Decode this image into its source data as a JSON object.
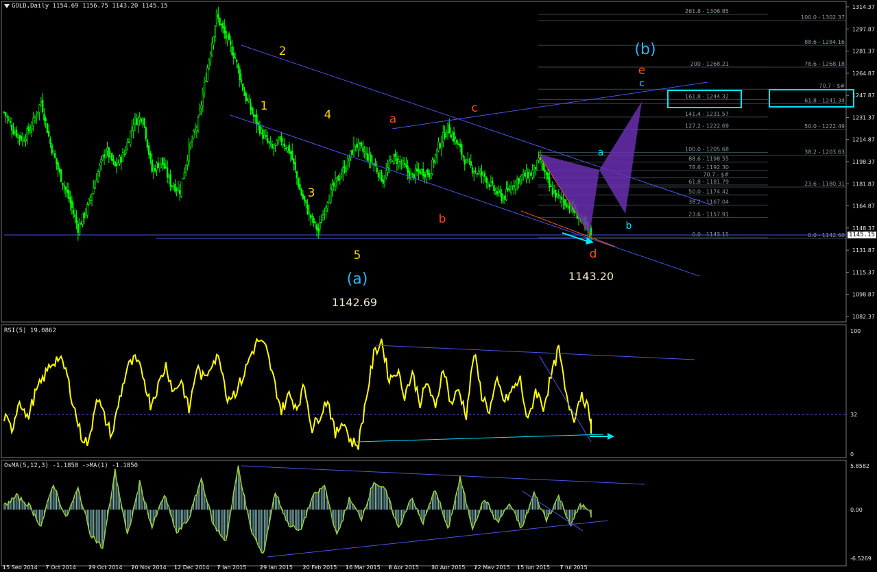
{
  "header": {
    "symbol": "GOLD,Daily",
    "open": "1154.69",
    "high": "1156.75",
    "low": "1143.20",
    "close": "1145.15"
  },
  "rsi_header": "RSI(5) 19.0862",
  "osma_header": "OsMA(5,12,3) -1.1850  ->MA(1) -1.1850",
  "price_badge": "1145.15",
  "colors": {
    "background": "#000000",
    "candle": "#00ff00",
    "trendline": "#4a55e6",
    "rsi": "#ffff00",
    "osma_line": "#9acd32",
    "osma_hist": "#7fb3b3",
    "wave_yellow": "#ffd400",
    "wave_orange": "#ff4a1a",
    "wave_cyan": "#29b6f6",
    "box": "#00e5ff",
    "pattern": "#6a2fb0"
  },
  "chart_data": [
    {
      "type": "candlestick",
      "title": "GOLD,Daily",
      "yticks": [
        "1314.37",
        "1297.87",
        "1281.37",
        "1264.87",
        "1247.87",
        "1231.37",
        "1214.87",
        "1198.37",
        "1181.87",
        "1164.87",
        "1148.37",
        "1131.87",
        "1115.37",
        "1098.87",
        "1082.37"
      ],
      "ylim": [
        1082.37,
        1314.37
      ],
      "xticks": [
        "15 Sep 2014",
        "7 Oct 2014",
        "29 Oct 2014",
        "20 Nov 2014",
        "12 Dec 2014",
        "7 Jan 2015",
        "29 Jan 2015",
        "20 Feb 2015",
        "16 Mar 2015",
        "8 Apr 2015",
        "30 Apr 2015",
        "22 May 2015",
        "15 Jun 2015",
        "7 Jul 2015"
      ],
      "close_path_anchors": [
        [
          0,
          1235
        ],
        [
          6,
          1222
        ],
        [
          12,
          1215
        ],
        [
          18,
          1225
        ],
        [
          24,
          1243
        ],
        [
          30,
          1212
        ],
        [
          36,
          1190
        ],
        [
          42,
          1172
        ],
        [
          48,
          1150
        ],
        [
          54,
          1165
        ],
        [
          60,
          1188
        ],
        [
          66,
          1208
        ],
        [
          72,
          1195
        ],
        [
          78,
          1205
        ],
        [
          84,
          1228
        ],
        [
          90,
          1232
        ],
        [
          96,
          1192
        ],
        [
          102,
          1200
        ],
        [
          108,
          1183
        ],
        [
          114,
          1178
        ],
        [
          120,
          1208
        ],
        [
          126,
          1228
        ],
        [
          132,
          1268
        ],
        [
          138,
          1306
        ],
        [
          144,
          1290
        ],
        [
          150,
          1275
        ],
        [
          156,
          1248
        ],
        [
          162,
          1232
        ],
        [
          168,
          1218
        ],
        [
          174,
          1208
        ],
        [
          180,
          1215
        ],
        [
          186,
          1205
        ],
        [
          192,
          1178
        ],
        [
          198,
          1160
        ],
        [
          204,
          1148
        ],
        [
          210,
          1172
        ],
        [
          216,
          1185
        ],
        [
          222,
          1196
        ],
        [
          228,
          1212
        ],
        [
          234,
          1205
        ],
        [
          240,
          1197
        ],
        [
          246,
          1185
        ],
        [
          252,
          1202
        ],
        [
          258,
          1198
        ],
        [
          264,
          1188
        ],
        [
          270,
          1192
        ],
        [
          276,
          1190
        ],
        [
          282,
          1210
        ],
        [
          288,
          1224
        ],
        [
          294,
          1212
        ],
        [
          300,
          1198
        ],
        [
          306,
          1192
        ],
        [
          312,
          1188
        ],
        [
          318,
          1178
        ],
        [
          324,
          1172
        ],
        [
          330,
          1182
        ],
        [
          336,
          1188
        ],
        [
          342,
          1190
        ],
        [
          348,
          1200
        ],
        [
          354,
          1180
        ],
        [
          360,
          1172
        ],
        [
          366,
          1168
        ],
        [
          372,
          1160
        ],
        [
          378,
          1150
        ],
        [
          381,
          1145
        ]
      ],
      "last_close": 1145.15,
      "wave_labels": {
        "yellow": [
          "1",
          "2",
          "3",
          "4",
          "5"
        ],
        "orange": [
          "a",
          "b",
          "c",
          "d",
          "e"
        ],
        "cyan": [
          "a",
          "b",
          "c"
        ],
        "major": [
          "(a)",
          "(b)"
        ]
      },
      "price_notes": [
        "1142.69",
        "1143.20"
      ],
      "fib_labels": [
        "261.8 - 1306.85",
        "100.0 - 1302.37",
        "88.6 - 1284.16",
        "200 - 1268.21",
        "78.6 - 1268.18",
        "70.7 - $#",
        "161.8 - 1244.32",
        "61.8 - 1241.34",
        "141.4 - 1231.57",
        "127.2 - 1222.69",
        "50.0 - 1222.49",
        "100.0 - 1205.68",
        "38.2 - 1203.63",
        "88.6 - 1198.55",
        "78.6 - 1192.30",
        "70.7 - $#",
        "61.8 - 1181.79",
        "23.6 - 1180.31",
        "50.0 - 1174.42",
        "38.2 - 1167.04",
        "23.6 - 1157.91",
        "0.0 - 1143.15",
        "0.0 - 1142.60"
      ]
    },
    {
      "type": "line",
      "title": "RSI(5) 19.0862",
      "yticks": [
        "100",
        "32",
        "0"
      ],
      "ylim": [
        0,
        100
      ],
      "level": 32,
      "anchors": [
        [
          0,
          30
        ],
        [
          5,
          20
        ],
        [
          10,
          45
        ],
        [
          15,
          28
        ],
        [
          20,
          48
        ],
        [
          25,
          60
        ],
        [
          30,
          72
        ],
        [
          35,
          78
        ],
        [
          40,
          68
        ],
        [
          45,
          40
        ],
        [
          50,
          15
        ],
        [
          55,
          8
        ],
        [
          60,
          48
        ],
        [
          65,
          30
        ],
        [
          70,
          15
        ],
        [
          75,
          45
        ],
        [
          80,
          70
        ],
        [
          85,
          76
        ],
        [
          90,
          65
        ],
        [
          95,
          40
        ],
        [
          100,
          55
        ],
        [
          105,
          72
        ],
        [
          110,
          50
        ],
        [
          115,
          60
        ],
        [
          120,
          35
        ],
        [
          125,
          70
        ],
        [
          130,
          60
        ],
        [
          135,
          75
        ],
        [
          140,
          78
        ],
        [
          145,
          45
        ],
        [
          150,
          50
        ],
        [
          155,
          62
        ],
        [
          160,
          80
        ],
        [
          165,
          92
        ],
        [
          170,
          85
        ],
        [
          175,
          60
        ],
        [
          180,
          35
        ],
        [
          185,
          48
        ],
        [
          190,
          38
        ],
        [
          195,
          55
        ],
        [
          200,
          20
        ],
        [
          205,
          32
        ],
        [
          210,
          45
        ],
        [
          215,
          15
        ],
        [
          220,
          28
        ],
        [
          225,
          10
        ],
        [
          230,
          8
        ],
        [
          235,
          45
        ],
        [
          240,
          80
        ],
        [
          245,
          92
        ],
        [
          250,
          60
        ],
        [
          255,
          68
        ],
        [
          260,
          48
        ],
        [
          265,
          65
        ],
        [
          270,
          42
        ],
        [
          275,
          58
        ],
        [
          280,
          35
        ],
        [
          285,
          72
        ],
        [
          290,
          40
        ],
        [
          295,
          52
        ],
        [
          300,
          32
        ],
        [
          305,
          82
        ],
        [
          310,
          48
        ],
        [
          315,
          35
        ],
        [
          320,
          58
        ],
        [
          325,
          42
        ],
        [
          330,
          52
        ],
        [
          335,
          60
        ],
        [
          340,
          25
        ],
        [
          345,
          52
        ],
        [
          350,
          38
        ],
        [
          355,
          62
        ],
        [
          360,
          85
        ],
        [
          365,
          45
        ],
        [
          370,
          30
        ],
        [
          375,
          50
        ],
        [
          380,
          32
        ],
        [
          384,
          19
        ]
      ]
    },
    {
      "type": "bar",
      "title": "OsMA(5,12,3) -1.1850  ->MA(1) -1.1850",
      "yticks": [
        "5.8582",
        "0.00",
        "-6.5269"
      ],
      "ylim": [
        -6.5269,
        5.8582
      ],
      "anchors": [
        [
          0,
          0.5
        ],
        [
          8,
          1.8
        ],
        [
          16,
          0.6
        ],
        [
          24,
          -2.2
        ],
        [
          32,
          3.5
        ],
        [
          40,
          -1.2
        ],
        [
          48,
          2.8
        ],
        [
          56,
          -3.2
        ],
        [
          64,
          -5.2
        ],
        [
          72,
          5.2
        ],
        [
          80,
          -3.6
        ],
        [
          88,
          3.6
        ],
        [
          96,
          -2.4
        ],
        [
          104,
          2.0
        ],
        [
          112,
          -3.2
        ],
        [
          120,
          -1.2
        ],
        [
          128,
          4.2
        ],
        [
          136,
          -2.2
        ],
        [
          144,
          -4.2
        ],
        [
          152,
          5.8
        ],
        [
          160,
          -2.6
        ],
        [
          168,
          -6.2
        ],
        [
          176,
          2.4
        ],
        [
          184,
          -1.8
        ],
        [
          192,
          -3.0
        ],
        [
          200,
          1.6
        ],
        [
          208,
          3.2
        ],
        [
          216,
          -3.6
        ],
        [
          224,
          1.4
        ],
        [
          232,
          -1.2
        ],
        [
          240,
          3.8
        ],
        [
          248,
          2.4
        ],
        [
          256,
          -2.6
        ],
        [
          264,
          1.6
        ],
        [
          272,
          -1.8
        ],
        [
          280,
          2.8
        ],
        [
          288,
          -2.8
        ],
        [
          296,
          4.2
        ],
        [
          304,
          -2.4
        ],
        [
          312,
          1.5
        ],
        [
          320,
          -1.8
        ],
        [
          328,
          0.8
        ],
        [
          336,
          -2.6
        ],
        [
          344,
          2.2
        ],
        [
          352,
          -1.4
        ],
        [
          360,
          1.8
        ],
        [
          368,
          -2.2
        ],
        [
          374,
          0.8
        ],
        [
          380,
          -0.4
        ],
        [
          384,
          -1.2
        ]
      ]
    }
  ]
}
